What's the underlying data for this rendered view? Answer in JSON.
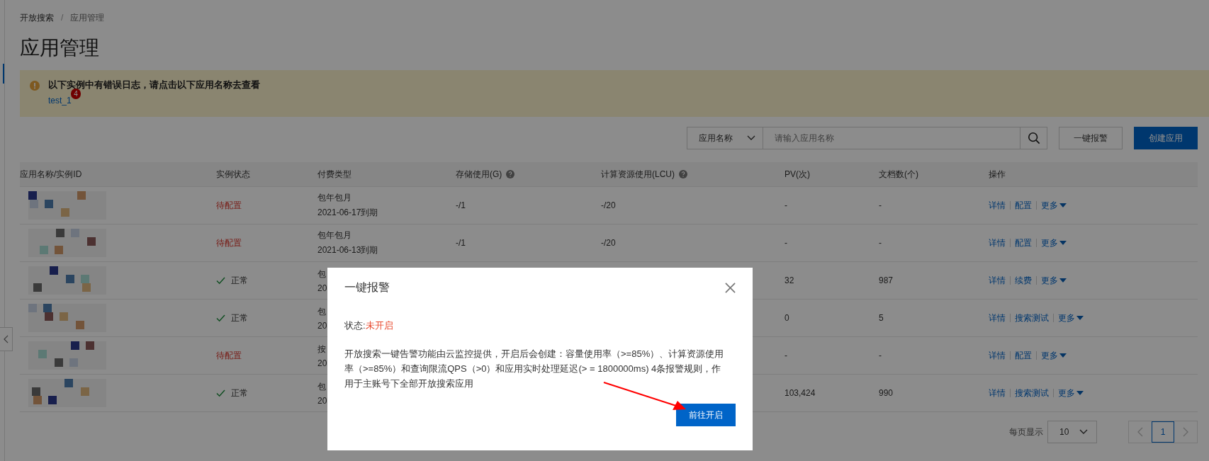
{
  "breadcrumb": [
    {
      "label": "开放搜索"
    },
    {
      "label": "应用管理"
    }
  ],
  "breadcrumb_separator": "/",
  "page_title": "应用管理",
  "alert": {
    "message": "以下实例中有错误日志，请点击以下应用名称去查看",
    "link": "test_1",
    "badge": "4"
  },
  "toolbar": {
    "filter_select": "应用名称",
    "search_placeholder": "请输入应用名称",
    "buttons": [
      {
        "label": "一键报警",
        "kind": "default"
      },
      {
        "label": "创建应用",
        "kind": "primary"
      }
    ]
  },
  "table": {
    "columns": [
      {
        "label": "应用名称/实例ID",
        "help": false
      },
      {
        "label": "实例状态",
        "help": false
      },
      {
        "label": "付费类型",
        "help": false
      },
      {
        "label": "存储使用(G)",
        "help": true
      },
      {
        "label": "计算资源使用(LCU)",
        "help": true
      },
      {
        "label": "PV(次)",
        "help": false
      },
      {
        "label": "文档数(个)",
        "help": false
      },
      {
        "label": "操作",
        "help": false
      }
    ],
    "rows": [
      {
        "status": {
          "kind": "pending",
          "label": "待配置"
        },
        "billing": [
          "包年包月",
          "2021-06-17到期"
        ],
        "storage": "-/1",
        "compute": "-/20",
        "pv": "-",
        "docs": "-",
        "actions": [
          "详情",
          "配置"
        ],
        "more": "更多"
      },
      {
        "status": {
          "kind": "pending",
          "label": "待配置"
        },
        "billing": [
          "包年包月",
          "2021-06-13到期"
        ],
        "storage": "-/1",
        "compute": "-/20",
        "pv": "-",
        "docs": "-",
        "actions": [
          "详情",
          "配置"
        ],
        "more": "更多"
      },
      {
        "status": {
          "kind": "normal",
          "label": "正常"
        },
        "billing": [
          "包",
          "20"
        ],
        "pv": "32",
        "docs": "987",
        "actions": [
          "详情",
          "续费"
        ],
        "more": "更多"
      },
      {
        "status": {
          "kind": "normal",
          "label": "正常"
        },
        "billing": [
          "包",
          "20"
        ],
        "pv": "0",
        "docs": "5",
        "actions": [
          "详情",
          "搜索测试"
        ],
        "more": "更多"
      },
      {
        "status": {
          "kind": "pending",
          "label": "待配置"
        },
        "billing": [
          "按",
          "20"
        ],
        "pv": "-",
        "docs": "-",
        "actions": [
          "详情",
          "配置"
        ],
        "more": "更多"
      },
      {
        "status": {
          "kind": "normal",
          "label": "正常"
        },
        "billing": [
          "包",
          "20"
        ],
        "pv": "103,424",
        "docs": "990",
        "actions": [
          "详情",
          "搜索测试"
        ],
        "more": "更多"
      }
    ]
  },
  "pagination": {
    "page_size_label": "每页显示",
    "page_size": "10",
    "pages": [
      {
        "label": "1",
        "selected": true
      }
    ]
  },
  "dialog": {
    "title": "一键报警",
    "status_label": "状态:",
    "status_value": "未开启",
    "description": "开放搜索一键告警功能由云监控提供，开启后会创建：容量使用率（>=85%）、计算资源使用率（>=85%）和查询限流QPS（>0）和应用实时处理延迟(> = 1800000ms) 4条报警规则，作用于主账号下全部开放搜索应用",
    "button": "前往开启"
  }
}
